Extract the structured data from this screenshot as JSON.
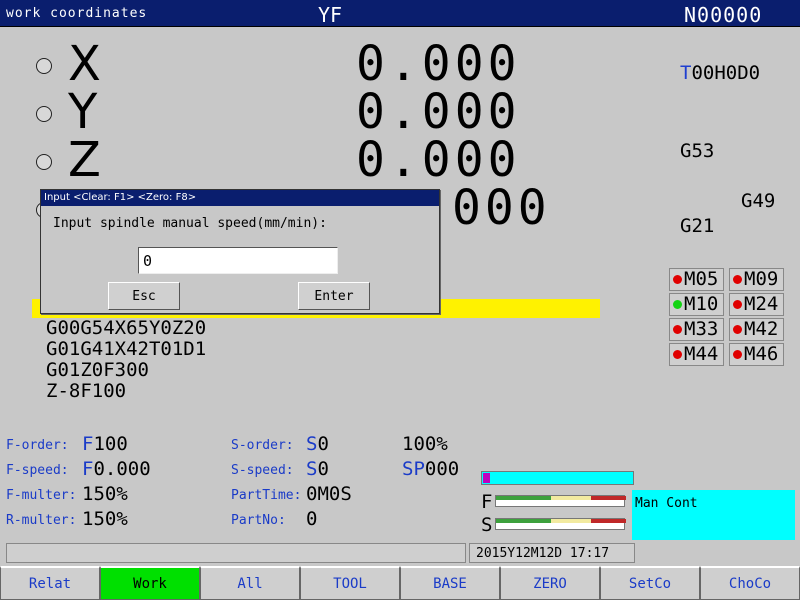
{
  "titlebar": {
    "left": "work coordinates",
    "mid": "YF",
    "right": "N00000"
  },
  "axes": [
    {
      "letter": "X",
      "value": "0.000"
    },
    {
      "letter": "Y",
      "value": "0.000"
    },
    {
      "letter": "Z",
      "value": "0.000"
    },
    {
      "letter": "",
      "value": "000"
    }
  ],
  "tool": {
    "t": "T",
    "rest": "00H0D0"
  },
  "gcodes": {
    "g53": "G53",
    "g49": "G49",
    "g21": "G21"
  },
  "mcodes": [
    {
      "label": "M05",
      "state": "off"
    },
    {
      "label": "M09",
      "state": "off"
    },
    {
      "label": "M10",
      "state": "on"
    },
    {
      "label": "M24",
      "state": "off"
    },
    {
      "label": "M33",
      "state": "off"
    },
    {
      "label": "M42",
      "state": "off"
    },
    {
      "label": "M44",
      "state": "off"
    },
    {
      "label": "M46",
      "state": "off"
    }
  ],
  "program": [
    "G00G54X65Y0Z20",
    "G01G41X42T01D1",
    "G01Z0F300",
    "Z-8F100"
  ],
  "status": {
    "f_order_label": "F-order:",
    "f_order_prefix": "F",
    "f_order_value": "100",
    "f_speed_label": "F-speed:",
    "f_speed_prefix": "F",
    "f_speed_value": "0.000",
    "f_multer_label": "F-multer:",
    "f_multer_value": "150%",
    "r_multer_label": "R-multer:",
    "r_multer_value": "150%",
    "s_order_label": "S-order:",
    "s_order_prefix": "S",
    "s_order_value": "0",
    "s_speed_label": "S-speed:",
    "s_speed_prefix": "S",
    "s_speed_value": "0",
    "parttime_label": "PartTime:",
    "parttime_value": "0M0S",
    "partno_label": "PartNo:",
    "partno_value": "0",
    "percent": "100%",
    "sp_prefix": "SP",
    "sp_value": "000"
  },
  "meters": {
    "f_label": "F",
    "s_label": "S"
  },
  "mode_text": "Man Cont",
  "datetime": "2015Y12M12D 17:17",
  "softkeys": [
    {
      "label": "Relat",
      "active": false
    },
    {
      "label": "Work",
      "active": true
    },
    {
      "label": "All",
      "active": false
    },
    {
      "label": "TOOL",
      "active": false
    },
    {
      "label": "BASE",
      "active": false
    },
    {
      "label": "ZERO",
      "active": false
    },
    {
      "label": "SetCo",
      "active": false
    },
    {
      "label": "ChoCo",
      "active": false
    }
  ],
  "dialog": {
    "title": "Input  <Clear: F1> <Zero: F8>",
    "prompt": "Input spindle manual speed(mm/min):",
    "input_value": "0",
    "esc_label": "Esc",
    "enter_label": "Enter"
  },
  "colors": {
    "title_bg": "#0a1e6e",
    "accent_blue": "#1a3bc8",
    "highlight": "#fff200",
    "cyan": "#00ffff",
    "active_key": "#00e000"
  }
}
